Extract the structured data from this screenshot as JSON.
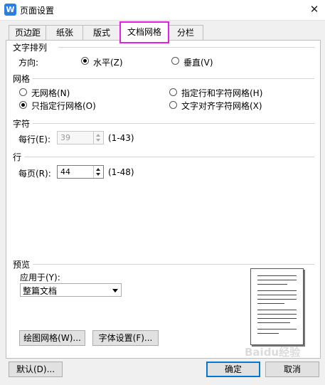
{
  "window": {
    "title": "页面设置",
    "app_icon": "W",
    "close_symbol": "✕"
  },
  "tabs": [
    {
      "label": "页边距"
    },
    {
      "label": "纸张"
    },
    {
      "label": "版式"
    },
    {
      "label": "文档网格",
      "active": true
    },
    {
      "label": "分栏"
    }
  ],
  "text_direction": {
    "title": "文字排列",
    "label": "方向:",
    "options": [
      {
        "label": "水平(Z)",
        "selected": true
      },
      {
        "label": "垂直(V)",
        "selected": false
      }
    ]
  },
  "grid": {
    "title": "网格",
    "options": [
      {
        "label": "无网格(N)",
        "selected": false
      },
      {
        "label": "指定行和字符网格(H)",
        "selected": false
      },
      {
        "label": "只指定行网格(O)",
        "selected": true
      },
      {
        "label": "文字对齐字符网格(X)",
        "selected": false
      }
    ]
  },
  "chars": {
    "title": "字符",
    "label": "每行(E):",
    "value": "39",
    "range": "(1-43)",
    "enabled": false
  },
  "lines": {
    "title": "行",
    "label": "每页(R):",
    "value": "44",
    "range": "(1-48)",
    "enabled": true
  },
  "preview": {
    "title": "预览",
    "apply_label": "应用于(Y):",
    "apply_value": "整篇文档"
  },
  "buttons": {
    "draw_grid": "绘图网格(W)...",
    "font_settings": "字体设置(F)...",
    "default": "默认(D)...",
    "ok": "确定",
    "cancel": "取消"
  },
  "watermark": "Baidu经验",
  "colors": {
    "tab_highlight": "#e61ee6",
    "app_icon": "#2b7de9",
    "default_button_border": "#0078d7"
  },
  "icons": [
    "wps-writer-icon",
    "close-icon",
    "radio-icon",
    "spinner-arrows-icon",
    "dropdown-arrow-icon",
    "page-preview-icon"
  ]
}
